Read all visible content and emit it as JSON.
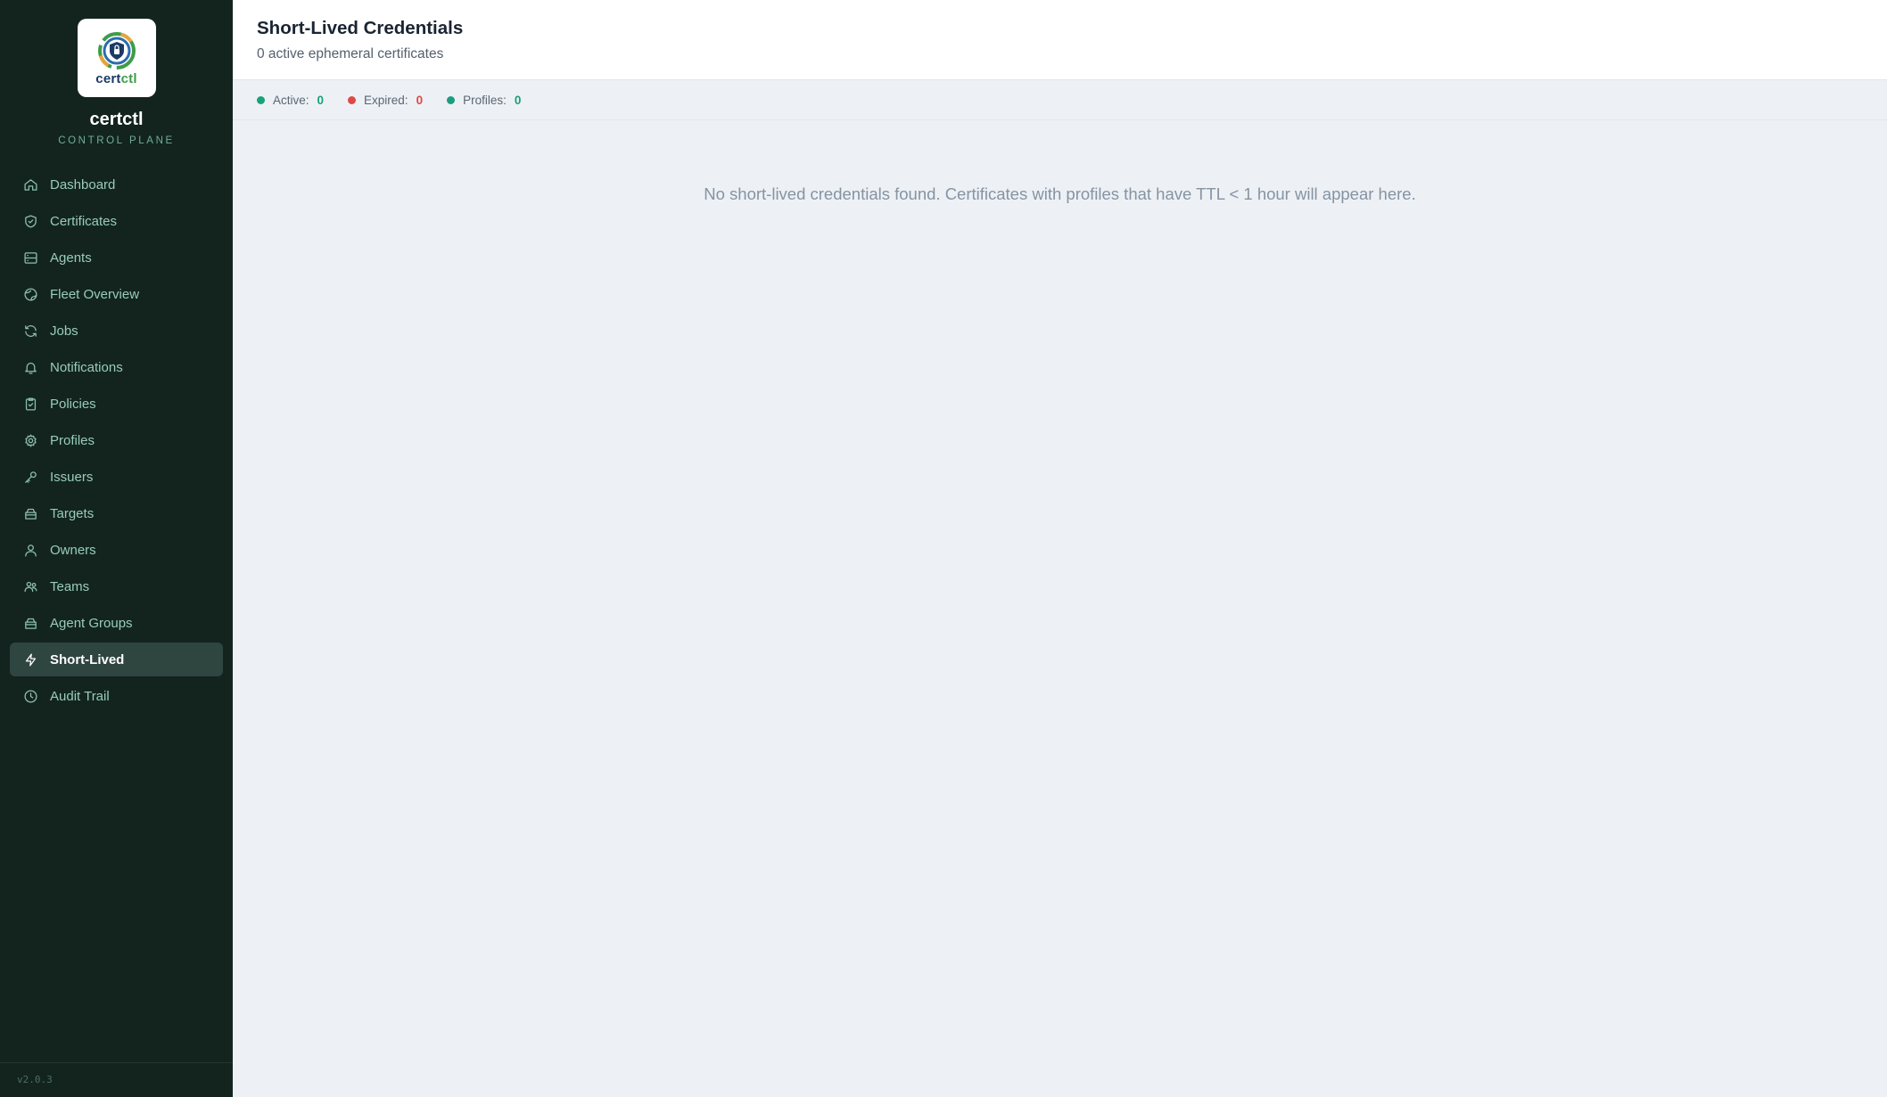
{
  "sidebar": {
    "logo_text_a": "cert",
    "logo_text_b": "ctl",
    "brand_name": "certctl",
    "brand_sub": "CONTROL PLANE",
    "items": [
      {
        "label": "Dashboard",
        "icon": "home-icon"
      },
      {
        "label": "Certificates",
        "icon": "shield-check-icon"
      },
      {
        "label": "Agents",
        "icon": "server-icon"
      },
      {
        "label": "Fleet Overview",
        "icon": "globe-icon"
      },
      {
        "label": "Jobs",
        "icon": "refresh-icon"
      },
      {
        "label": "Notifications",
        "icon": "bell-icon"
      },
      {
        "label": "Policies",
        "icon": "clipboard-check-icon"
      },
      {
        "label": "Profiles",
        "icon": "gear-icon"
      },
      {
        "label": "Issuers",
        "icon": "key-icon"
      },
      {
        "label": "Targets",
        "icon": "box-icon"
      },
      {
        "label": "Owners",
        "icon": "user-icon"
      },
      {
        "label": "Teams",
        "icon": "users-icon"
      },
      {
        "label": "Agent Groups",
        "icon": "box-icon"
      },
      {
        "label": "Short-Lived",
        "icon": "lightning-icon",
        "active": true
      },
      {
        "label": "Audit Trail",
        "icon": "clock-icon"
      }
    ],
    "version": "v2.0.3"
  },
  "header": {
    "title": "Short-Lived Credentials",
    "subtitle": "0 active ephemeral certificates"
  },
  "stats": {
    "active_label": "Active:",
    "active_value": "0",
    "expired_label": "Expired:",
    "expired_value": "0",
    "profiles_label": "Profiles:",
    "profiles_value": "0"
  },
  "empty_message": "No short-lived credentials found. Certificates with profiles that have TTL < 1 hour will appear here.",
  "colors": {
    "sidebar_bg": "#13241f",
    "active_green": "#16a37a",
    "expired_red": "#e04848",
    "profiles_teal": "#1d9c7e"
  }
}
